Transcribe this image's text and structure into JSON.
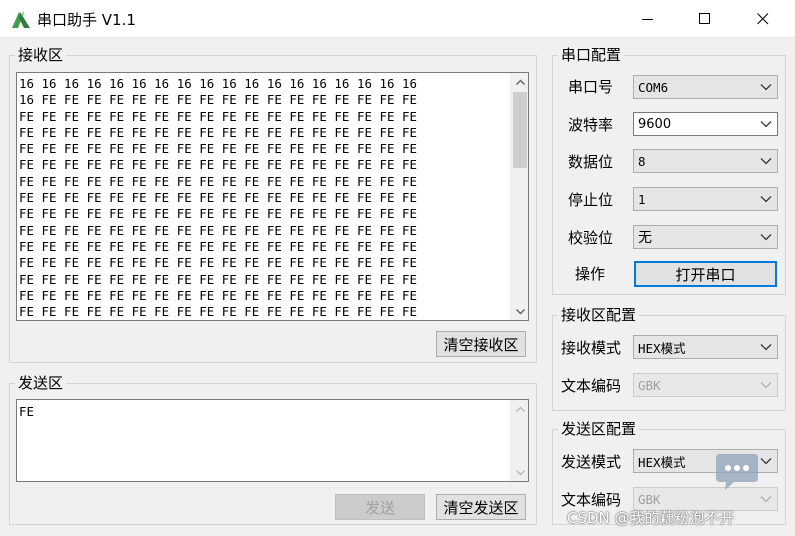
{
  "window": {
    "title": "串口助手 V1.1"
  },
  "receive": {
    "group_title": "接收区",
    "text": "16 16 16 16 16 16 16 16 16 16 16 16 16 16 16 16 16 16\n16 FE FE FE FE FE FE FE FE FE FE FE FE FE FE FE FE FE\nFE FE FE FE FE FE FE FE FE FE FE FE FE FE FE FE FE FE\nFE FE FE FE FE FE FE FE FE FE FE FE FE FE FE FE FE FE\nFE FE FE FE FE FE FE FE FE FE FE FE FE FE FE FE FE FE\nFE FE FE FE FE FE FE FE FE FE FE FE FE FE FE FE FE FE\nFE FE FE FE FE FE FE FE FE FE FE FE FE FE FE FE FE FE\nFE FE FE FE FE FE FE FE FE FE FE FE FE FE FE FE FE FE\nFE FE FE FE FE FE FE FE FE FE FE FE FE FE FE FE FE FE\nFE FE FE FE FE FE FE FE FE FE FE FE FE FE FE FE FE FE\nFE FE FE FE FE FE FE FE FE FE FE FE FE FE FE FE FE FE\nFE FE FE FE FE FE FE FE FE FE FE FE FE FE FE FE FE FE\nFE FE FE FE FE FE FE FE FE FE FE FE FE FE FE FE FE FE\nFE FE FE FE FE FE FE FE FE FE FE FE FE FE FE FE FE FE\nFE FE FE FE FE FE FE FE FE FE FE FE FE FE FE FE FE FE",
    "clear_button": "清空接收区"
  },
  "send": {
    "group_title": "发送区",
    "text": "FE",
    "send_button": "发送",
    "clear_button": "清空发送区"
  },
  "serial_config": {
    "group_title": "串口配置",
    "port_label": "串口号",
    "port_value": "COM6",
    "baud_label": "波特率",
    "baud_value": "9600",
    "databits_label": "数据位",
    "databits_value": "8",
    "stopbits_label": "停止位",
    "stopbits_value": "1",
    "parity_label": "校验位",
    "parity_value": "无",
    "operate_label": "操作",
    "open_button": "打开串口"
  },
  "recv_config": {
    "group_title": "接收区配置",
    "mode_label": "接收模式",
    "mode_value": "HEX模式",
    "encoding_label": "文本编码",
    "encoding_value": "GBK"
  },
  "send_config": {
    "group_title": "发送区配置",
    "mode_label": "发送模式",
    "mode_value": "HEX模式",
    "encoding_label": "文本编码",
    "encoding_value": "GBK"
  },
  "watermark": "CSDN @我的藕粉泡不开"
}
